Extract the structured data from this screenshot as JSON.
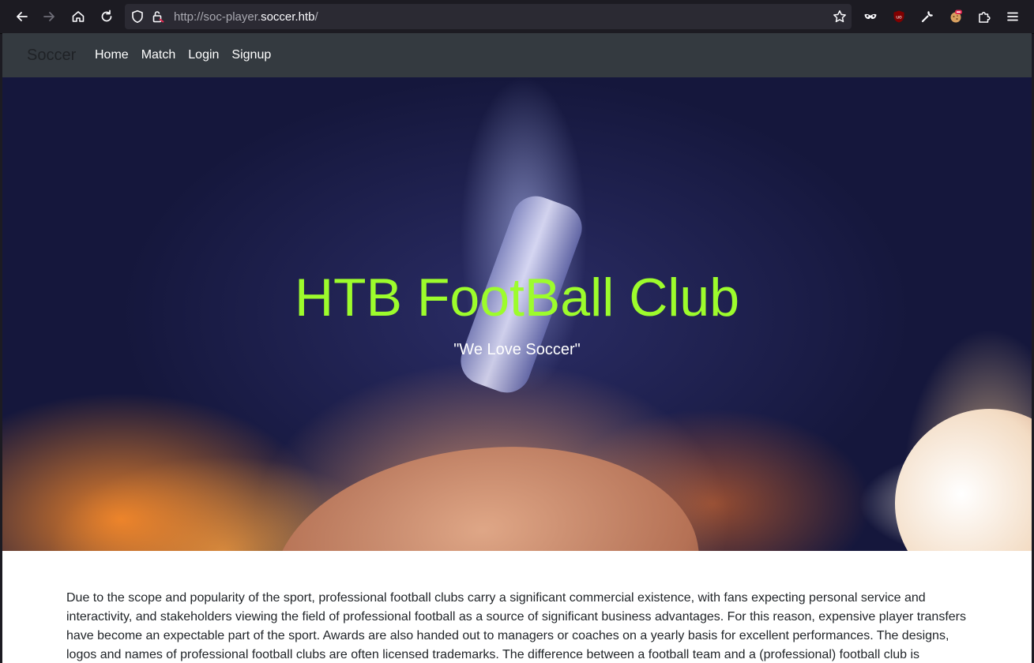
{
  "browser": {
    "url_prefix": "http://soc-player.",
    "url_domain": "soccer.htb",
    "url_suffix": "/"
  },
  "navbar": {
    "brand": "Soccer",
    "links": [
      "Home",
      "Match",
      "Login",
      "Signup"
    ]
  },
  "hero": {
    "title": "HTB FootBall Club",
    "subtitle": "\"We Love Soccer\""
  },
  "content": {
    "paragraph": "Due to the scope and popularity of the sport, professional football clubs carry a significant commercial existence, with fans expecting personal service and interactivity, and stakeholders viewing the field of professional football as a source of significant business advantages. For this reason, expensive player transfers have become an expectable part of the sport. Awards are also handed out to managers or coaches on a yearly basis for excellent performances. The designs, logos and names of professional football clubs are often licensed trademarks. The difference between a football team and a (professional) football club is"
  },
  "icons": {
    "back": "back-arrow-icon",
    "forward": "forward-arrow-icon",
    "home": "home-icon",
    "reload": "reload-icon",
    "shield": "shield-icon",
    "lock": "insecure-lock-icon",
    "bookmark": "star-icon",
    "extensions": [
      "mask-icon",
      "ublock-icon",
      "wrench-icon",
      "cookie-icon",
      "puzzle-icon",
      "menu-icon"
    ]
  },
  "colors": {
    "hero_title": "#9dfc2c",
    "navbar_bg": "#343a40",
    "chrome_bg": "#1c1b22"
  }
}
